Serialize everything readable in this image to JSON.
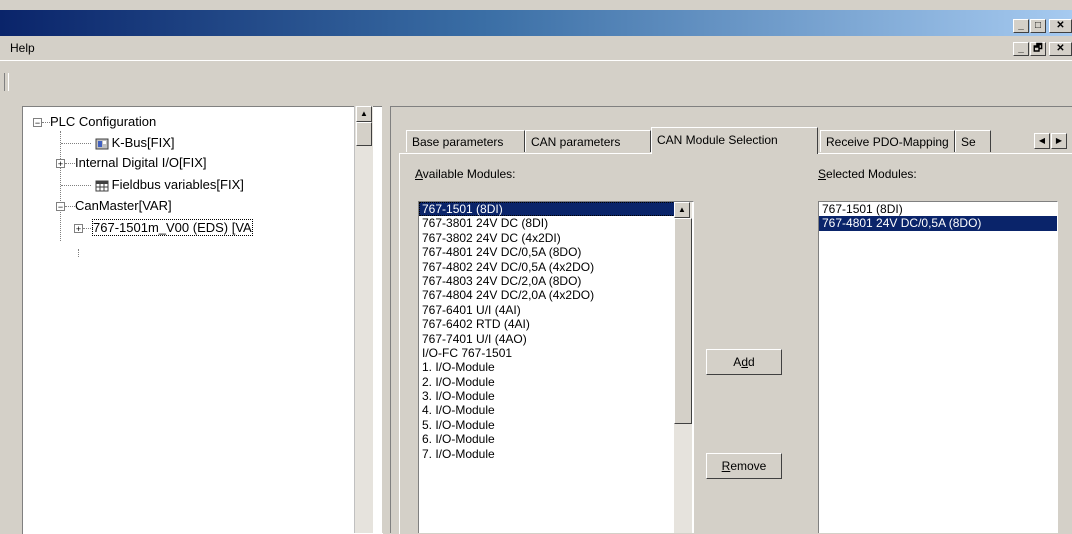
{
  "menu": {
    "help_label": "Help"
  },
  "window_controls": {
    "minimize": "_",
    "maximize": "□",
    "restore": "🗗",
    "close": "✕"
  },
  "tree": {
    "root_label": "PLC Configuration",
    "items": [
      {
        "label": "K-Bus[FIX]",
        "icon": "module-icon"
      },
      {
        "label": "Internal Digital I/O[FIX]",
        "icon": "expand-plus-icon"
      },
      {
        "label": "Fieldbus variables[FIX]",
        "icon": "table-icon"
      },
      {
        "label": "CanMaster[VAR]",
        "icon": "collapse-minus-icon"
      },
      {
        "label": "767-1501m_V00 (EDS)  [VA",
        "icon": "expand-plus-icon"
      }
    ]
  },
  "tabs": [
    {
      "label": "Base parameters"
    },
    {
      "label": "CAN parameters"
    },
    {
      "label": "CAN Module Selection"
    },
    {
      "label": "Receive PDO-Mapping"
    },
    {
      "label": "Se"
    }
  ],
  "available_label": "Available Modules:",
  "selected_label": "Selected Modules:",
  "available_modules": [
    "767-1501 (8DI)",
    "767-3801 24V DC (8DI)",
    "767-3802 24V DC (4x2DI)",
    "767-4801 24V DC/0,5A (8DO)",
    "767-4802 24V DC/0,5A (4x2DO)",
    "767-4803 24V DC/2,0A (8DO)",
    "767-4804 24V DC/2,0A (4x2DO)",
    "767-6401 U/I (4AI)",
    "767-6402 RTD (4AI)",
    "767-7401 U/I (4AO)",
    "I/O-FC 767-1501",
    "1. I/O-Module",
    "2. I/O-Module",
    "3. I/O-Module",
    "4. I/O-Module",
    "5. I/O-Module",
    "6. I/O-Module",
    "7. I/O-Module"
  ],
  "selected_modules": [
    "767-1501 (8DI)",
    "767-4801 24V DC/0,5A (8DO)"
  ],
  "buttons": {
    "add": "Add",
    "remove": "Remove"
  },
  "colors": {
    "selection": "#0a246a",
    "title_gradient_start": "#0a246a",
    "title_gradient_end": "#a6caf0"
  }
}
